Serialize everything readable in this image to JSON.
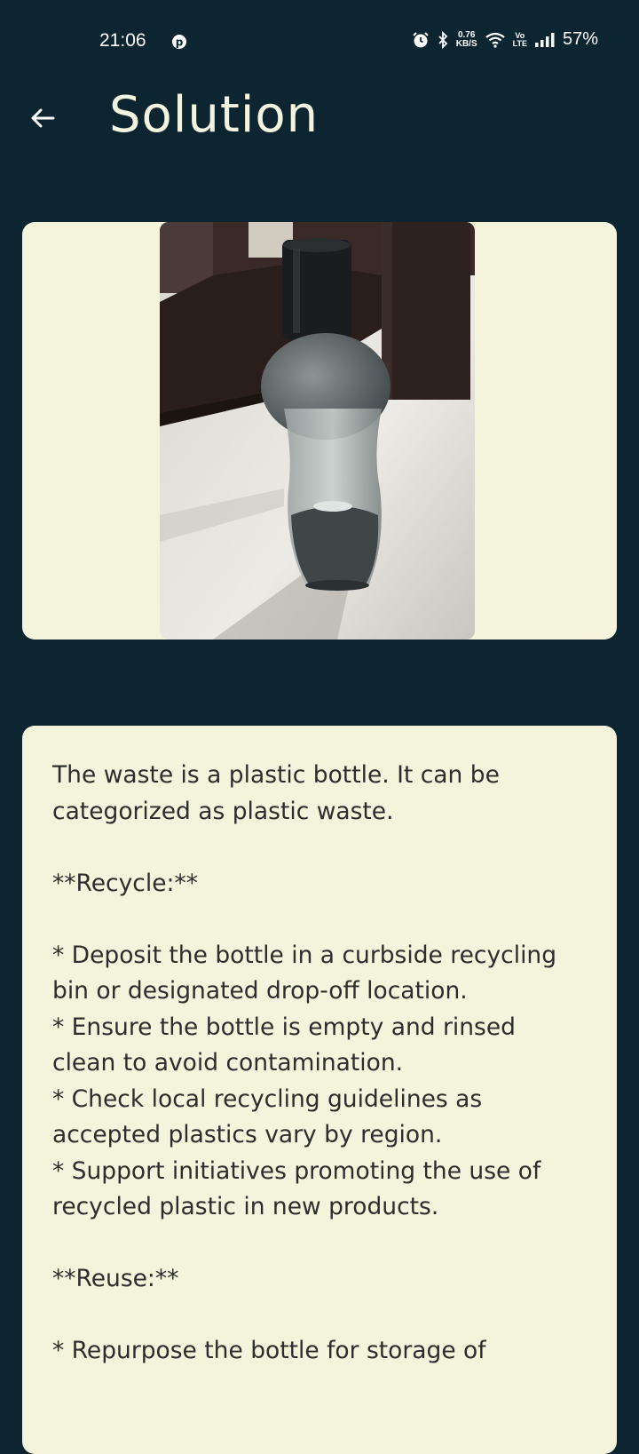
{
  "status_bar": {
    "time": "21:06",
    "net_speed_value": "0.76",
    "net_speed_unit": "KB/S",
    "volte_top": "Vo",
    "volte_bottom": "LTE",
    "battery": "57%"
  },
  "app_bar": {
    "title": "Solution"
  },
  "image_card": {
    "image_subject": "plastic-bottle-photo"
  },
  "solution": {
    "text": "The waste is a plastic bottle. It can be categorized as plastic waste.\n\n**Recycle:**\n\n* Deposit the bottle in a curbside recycling bin or designated drop-off location.\n* Ensure the bottle is empty and rinsed clean to avoid contamination.\n* Check local recycling guidelines as accepted plastics vary by region.\n* Support initiatives promoting the use of recycled plastic in new products.\n\n**Reuse:**\n\n* Repurpose the bottle for storage of"
  },
  "colors": {
    "background": "#0c2530",
    "card": "#f4f4dc",
    "text": "#2d2d2d",
    "title": "#f3f4df"
  }
}
